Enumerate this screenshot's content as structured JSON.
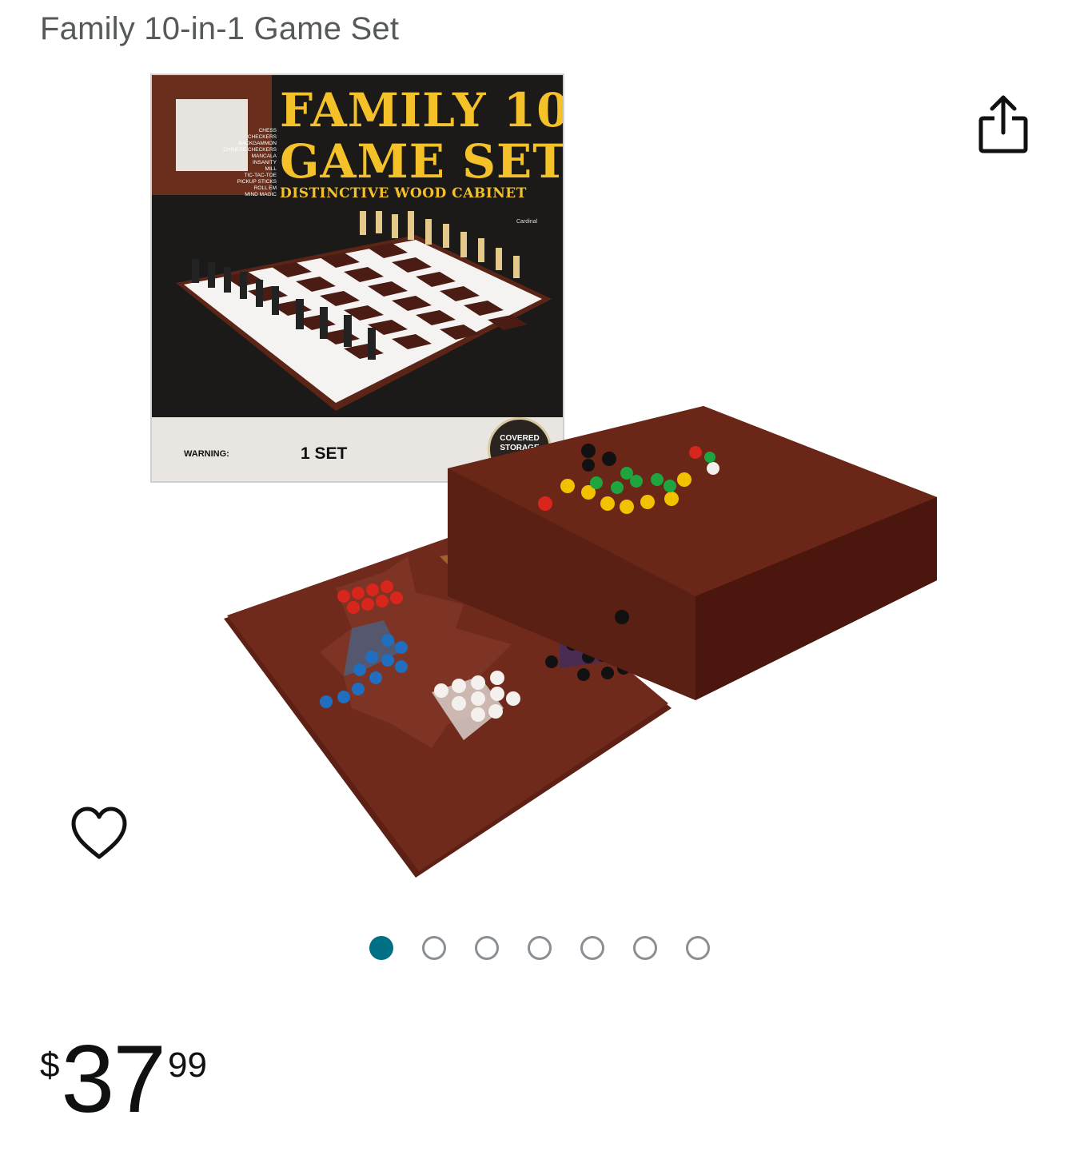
{
  "product": {
    "title": "Family 10-in-1 Game Set"
  },
  "box_art": {
    "title_line1": "FAMILY 10",
    "title_line2": "GAME SET",
    "subtitle": "DISTINCTIVE WOOD CABINET",
    "games": [
      "CHESS",
      "CHECKERS",
      "BACKGAMMON",
      "CHINESE CHECKERS",
      "MANCALA",
      "INSANITY",
      "MILL",
      "TIC-TAC-TOE",
      "PICKUP STICKS",
      "ROLL EM",
      "MIND MAGIC"
    ],
    "warning": "WARNING:",
    "quantity": "1 SET",
    "badge": "COVERED STORAGE CASE",
    "brand": "Cardinal"
  },
  "icons": {
    "share": "share-icon",
    "wishlist": "heart-icon"
  },
  "carousel": {
    "total": 7,
    "active_index": 0,
    "accent_color": "#007185"
  },
  "price": {
    "symbol": "$",
    "whole": "37",
    "fraction": "99"
  }
}
